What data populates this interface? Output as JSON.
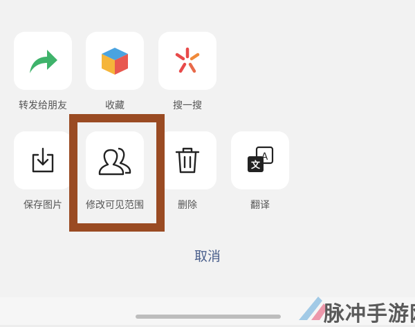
{
  "actions_row1": [
    {
      "label": "转发给朋友",
      "icon": "share-arrow-icon"
    },
    {
      "label": "收藏",
      "icon": "cube-icon"
    },
    {
      "label": "搜一搜",
      "icon": "search-spark-icon"
    }
  ],
  "actions_row2": [
    {
      "label": "保存图片",
      "icon": "download-icon"
    },
    {
      "label": "修改可见范围",
      "icon": "people-icon"
    },
    {
      "label": "删除",
      "icon": "trash-icon"
    },
    {
      "label": "翻译",
      "icon": "translate-icon"
    }
  ],
  "cancel_label": "取消",
  "watermark_text": "脉冲手游网",
  "colors": {
    "highlight_border": "#9a4b23",
    "cancel_text": "#4a5f8c",
    "share_arrow": "#3fb36b",
    "tile_background": "#ffffff",
    "sheet_background": "#f2f2f2"
  }
}
